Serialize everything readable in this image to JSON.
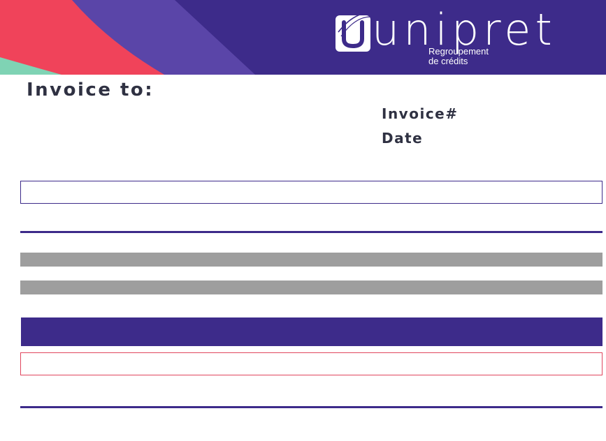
{
  "brand": {
    "name": "unipret",
    "tagline_line1": "Regroupement",
    "tagline_line2": "de crédits",
    "colors": {
      "primary": "#3d2b8a",
      "red": "#f0435a",
      "violet": "#5a45a8",
      "mint": "#7fd3b4"
    }
  },
  "invoice": {
    "heading": "Invoice to:",
    "number_label": "Invoice#",
    "date_label": "Date"
  },
  "icons": {
    "logo_mark": "u-logo-mark-icon"
  }
}
